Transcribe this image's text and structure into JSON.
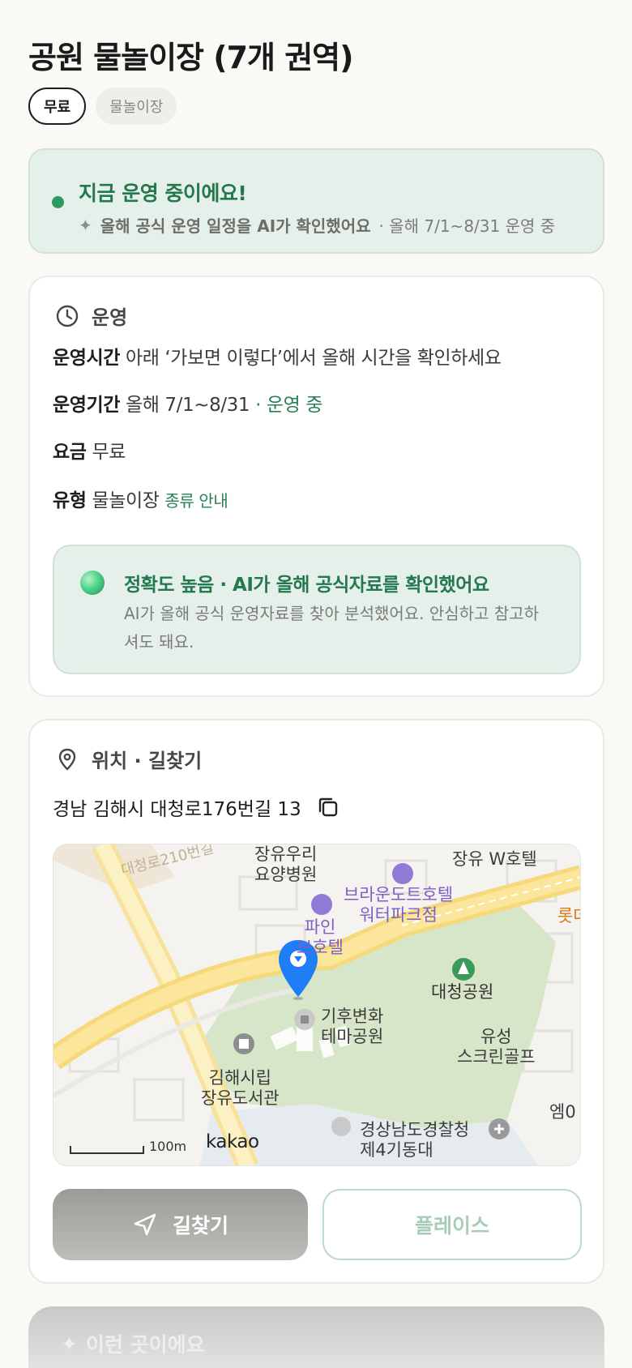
{
  "page_title": "공원 물놀이장 (7개 권역)",
  "chips": [
    {
      "label": "무료"
    },
    {
      "label": "물놀이장"
    }
  ],
  "status": {
    "title": "지금 운영 중이에요!",
    "sub_strong": "올해 공식 운영 일정을 AI가 확인했어요",
    "sub_rest": "· 올해 7/1~8/31 운영 중",
    "accent": "#2e9a63"
  },
  "operation": {
    "header": "운영",
    "hours_key": "운영시간",
    "hours_value": "아래 ‘가보면 이렇다’에서 올해 시간을 확인하세요",
    "period_key": "운영기간",
    "period_value": "올해 7/1~8/31",
    "period_status": "· 운영 중",
    "fee_key": "요금",
    "fee_value": "무료",
    "type_key": "유형",
    "type_value": "물놀이장",
    "type_link": "종류 안내",
    "ai_title": "정확도 높음 · AI가 올해 공식자료를 확인했어요",
    "ai_desc": "AI가 올해 공식 운영자료를 찾아 분석했어요. 안심하고 참고하셔도 돼요."
  },
  "location": {
    "header": "위치 · 길찾기",
    "address": "경남 김해시 대청로176번길 13",
    "map": {
      "road": "대청로210번길",
      "labels": {
        "hospital": "장유우리\n요양병원",
        "hotel_w": "장유 W호텔",
        "brown": "브라운도트호텔\n워터파크점",
        "lotte": "롯데",
        "fine": "파인\n브호텔",
        "park": "대청공원",
        "climate": "기후변화\n테마공원",
        "golf": "유성\n스크린골프",
        "library": "김해시립\n장유도서관",
        "em": "엠0",
        "police": "경상남도경찰청\n제4기동대"
      },
      "scale": "100m",
      "brand": "kakao"
    },
    "nav_button": "길찾기",
    "place_button": "플레이스"
  },
  "teaser": {
    "label": "이런 곳이에요"
  }
}
